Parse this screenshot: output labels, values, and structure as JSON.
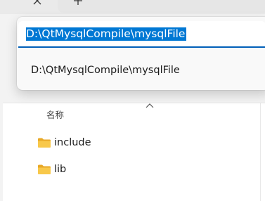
{
  "address_bar": {
    "value": "D:\\QtMysqlCompile\\mysqlFile",
    "suggestions": [
      "D:\\QtMysqlCompile\\mysqlFile"
    ]
  },
  "file_list": {
    "column_name_label": "名称",
    "items": [
      {
        "name": "include",
        "icon": "folder-icon"
      },
      {
        "name": "lib",
        "icon": "folder-icon"
      }
    ]
  },
  "colors": {
    "selection": "#0078d4",
    "focus_underline": "#005fb8",
    "folder_body": "#f8c84a",
    "folder_tab": "#e8a826"
  }
}
